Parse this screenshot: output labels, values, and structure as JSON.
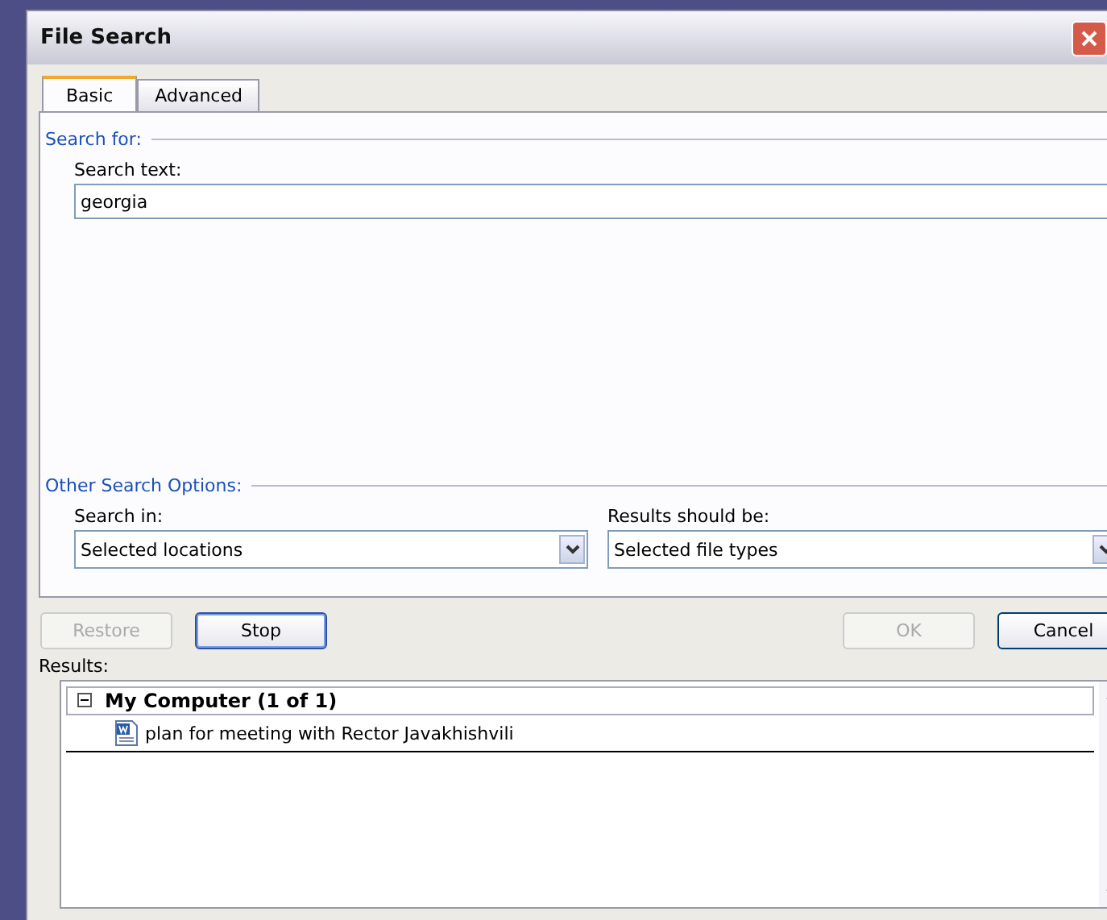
{
  "window": {
    "title": "File Search"
  },
  "tabs": [
    {
      "label": "Basic",
      "selected": true
    },
    {
      "label": "Advanced",
      "selected": false
    }
  ],
  "search_for": {
    "heading": "Search for:",
    "label": "Search text:",
    "value": "georgia"
  },
  "other_options": {
    "heading": "Other Search Options:",
    "dropdowns": [
      {
        "label": "Search in:",
        "value": "Selected locations"
      },
      {
        "label": "Results should be:",
        "value": "Selected file types"
      }
    ]
  },
  "buttons": [
    {
      "label": "Restore",
      "disabled": true,
      "focused": false
    },
    {
      "label": "Stop",
      "disabled": false,
      "focused": true
    },
    {
      "label": "OK",
      "disabled": true,
      "focused": false
    },
    {
      "label": "Cancel",
      "disabled": false,
      "focused": false
    }
  ],
  "results": {
    "label": "Results:",
    "groups": [
      {
        "label": "My Computer  (1 of 1)",
        "expanded": true,
        "children": [
          {
            "label": "plan for meeting with Rector Javakhishvili"
          }
        ]
      }
    ]
  }
}
